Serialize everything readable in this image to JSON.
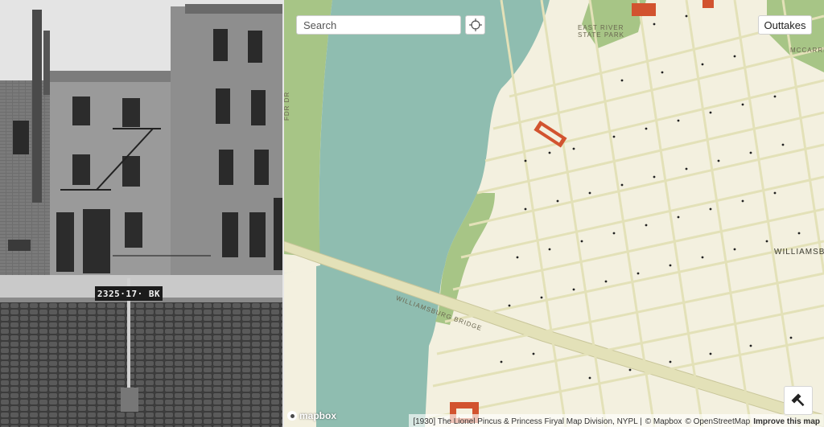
{
  "photo": {
    "tax_label": "2325·17· BK"
  },
  "search": {
    "placeholder": "Search"
  },
  "controls": {
    "outtakes_label": "Outtakes"
  },
  "map_labels": {
    "park": "EAST RIVER STATE PARK",
    "williamsburg": "WILLIAMSBURG",
    "bridge": "WILLIAMSBURG BRIDGE",
    "fdr": "FDR DR",
    "mccarren": "MCCARRE"
  },
  "mapbox": {
    "logo_text": "mapbox"
  },
  "attribution": {
    "text": "[1930] The Lionel Pincus & Princess Firyal Map Division, NYPL |",
    "mapbox": "© Mapbox",
    "osm": "© OpenStreetMap",
    "improve": "Improve this map"
  },
  "colors": {
    "water": "#8fbdb0",
    "land": "#f3f0df",
    "park": "#a7c586",
    "street": "#e3e1b8",
    "highlight": "#d2532f"
  },
  "icons": {
    "locate": "crosshair-icon",
    "tool": "hammer-icon"
  }
}
